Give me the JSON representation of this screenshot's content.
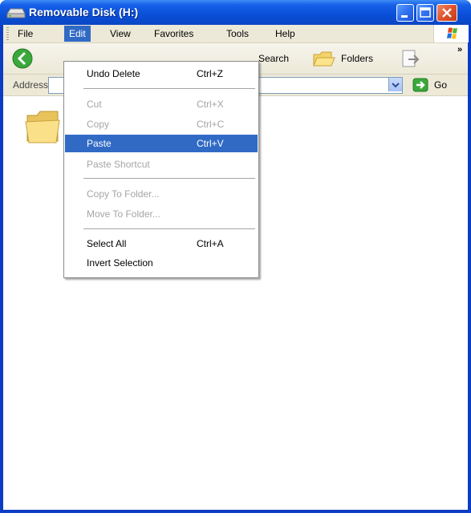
{
  "window": {
    "title": "Removable Disk (H:)"
  },
  "menubar": {
    "items": [
      {
        "label": "File"
      },
      {
        "label": "Edit"
      },
      {
        "label": "View"
      },
      {
        "label": "Favorites"
      },
      {
        "label": "Tools"
      },
      {
        "label": "Help"
      }
    ],
    "active": "Edit"
  },
  "toolbar": {
    "search_label": "Search",
    "folders_label": "Folders",
    "overflow_label": "»"
  },
  "address": {
    "label": "Address",
    "value": "",
    "go_label": "Go"
  },
  "edit_menu": {
    "items": [
      {
        "label": "Undo Delete",
        "shortcut": "Ctrl+Z",
        "enabled": true
      },
      {
        "label": "Cut",
        "shortcut": "Ctrl+X",
        "enabled": false
      },
      {
        "label": "Copy",
        "shortcut": "Ctrl+C",
        "enabled": false
      },
      {
        "label": "Paste",
        "shortcut": "Ctrl+V",
        "enabled": true,
        "highlighted": true
      },
      {
        "label": "Paste Shortcut",
        "shortcut": "",
        "enabled": false
      },
      {
        "label": "Copy To Folder...",
        "shortcut": "",
        "enabled": false
      },
      {
        "label": "Move To Folder...",
        "shortcut": "",
        "enabled": false
      },
      {
        "label": "Select All",
        "shortcut": "Ctrl+A",
        "enabled": true
      },
      {
        "label": "Invert Selection",
        "shortcut": "",
        "enabled": true
      }
    ]
  },
  "colors": {
    "titlebar": "#0a4fd8",
    "highlight": "#316ac5",
    "disabled_text": "#a5a5a5",
    "menubar_bg": "#ece9d8"
  },
  "icons": [
    "drive-icon",
    "minimize-icon",
    "maximize-icon",
    "close-icon",
    "windows-logo-icon",
    "back-arrow-icon",
    "search-icon",
    "folders-icon",
    "move-to-icon",
    "dropdown-arrow-icon",
    "go-arrow-icon",
    "folder-icon"
  ]
}
